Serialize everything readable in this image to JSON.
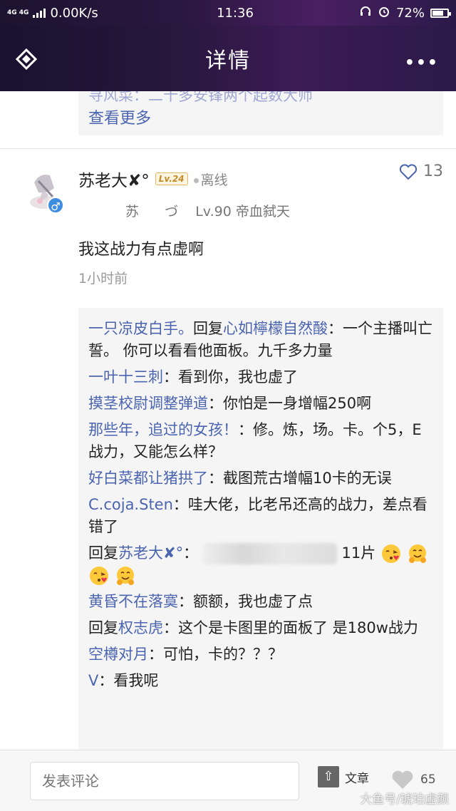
{
  "status_bar": {
    "network": "4G 4G",
    "speed": "0.00K/s",
    "time": "11:36",
    "battery": "72%"
  },
  "header": {
    "title": "详情",
    "more": "•••"
  },
  "previous_comment": {
    "cut_text": "寻风菜：二十多安锋两个起数大师",
    "view_more": "查看更多"
  },
  "post": {
    "username": "苏老大✘°",
    "level_badge": "Lv.24",
    "status": "离线",
    "likes": "13",
    "sub_left": "苏",
    "sub_mid": "づ",
    "sub_right": "Lv.90 帝血弑天",
    "text": "我这战力有点虚啊",
    "time": "1小时前"
  },
  "replies": [
    {
      "name": "一只凉皮白手。",
      "mid": "回复",
      "target": "心如檸檬自然酸",
      "text": "：一个主播叫亡誓。 你可以看看他面板。九千多力量"
    },
    {
      "name": "一叶十三刺",
      "text": "：看到你，我也虚了"
    },
    {
      "name": "摸茎校尉调整弹道",
      "text": "：你怕是一身增幅250啊"
    },
    {
      "name": "那些年，追过的女孩！",
      "text": "：修。炼，场。卡。个5，E战力，又能怎么样？"
    },
    {
      "name": "好白菜都让猪拱了",
      "text": "：截图荒古增幅10卡的无误"
    },
    {
      "name": "C.coja.Sten",
      "text": "：哇大佬，比老吊还高的战力，差点看错了"
    },
    {
      "prefix": "回复",
      "name": "苏老大✘°",
      "colon": "：",
      "tail": "11片"
    },
    {
      "name": "黄昏不在落寞",
      "text": "：额额，我也虚了点"
    },
    {
      "prefix": "回复",
      "name": "权志虎",
      "text": "：这个是卡图里的面板了  是180w战力"
    },
    {
      "name": "空樽对月",
      "text": "：可怕，卡的？？？"
    },
    {
      "name": "ᐯ",
      "text": "：看我呢"
    }
  ],
  "bottom": {
    "comment_placeholder": "发表评论",
    "article_label": "文章",
    "like_count": "65",
    "watermark": "大鱼号/琥珀虚颜"
  }
}
